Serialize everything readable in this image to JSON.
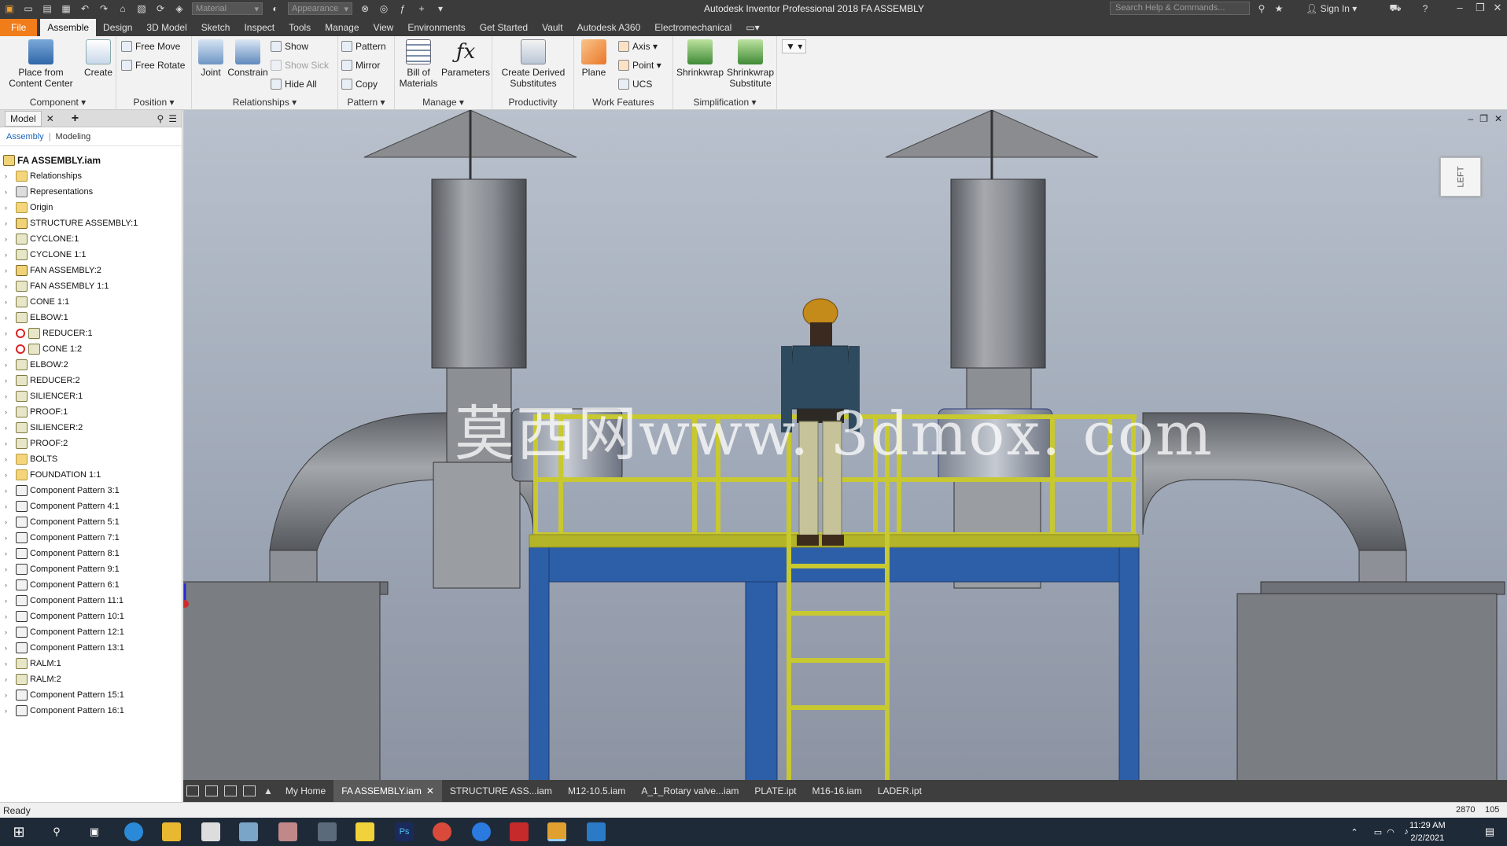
{
  "titlebar": {
    "title": "Autodesk Inventor Professional 2018   FA ASSEMBLY",
    "material_combo": "Material",
    "appearance_combo": "Appearance",
    "search_placeholder": "Search Help & Commands...",
    "sign_in": "Sign In"
  },
  "ribbon_tabs": [
    "File",
    "Assemble",
    "Design",
    "3D Model",
    "Sketch",
    "Inspect",
    "Tools",
    "Manage",
    "View",
    "Environments",
    "Get Started",
    "Vault",
    "Autodesk A360",
    "Electromechanical"
  ],
  "active_tab": "Assemble",
  "ribbon": {
    "component": {
      "title": "Component ▾",
      "place": "Place from\nContent Center",
      "create": "Create"
    },
    "position": {
      "title": "Position ▾",
      "free_move": "Free Move",
      "free_rotate": "Free Rotate"
    },
    "relationships": {
      "title": "Relationships ▾",
      "joint": "Joint",
      "constrain": "Constrain",
      "show": "Show",
      "show_sick": "Show Sick",
      "hide_all": "Hide All"
    },
    "pattern": {
      "title": "Pattern ▾",
      "pattern": "Pattern",
      "mirror": "Mirror",
      "copy": "Copy"
    },
    "manage": {
      "title": "Manage ▾",
      "bom": "Bill of\nMaterials",
      "parameters": "Parameters"
    },
    "productivity": {
      "title": "Productivity",
      "derived": "Create Derived\nSubstitutes"
    },
    "work_features": {
      "title": "Work Features",
      "plane": "Plane",
      "axis": "Axis",
      "point": "Point",
      "ucs": "UCS"
    },
    "simplification": {
      "title": "Simplification ▾",
      "shrinkwrap": "Shrinkwrap",
      "shrinkwrap_sub": "Shrinkwrap\nSubstitute"
    }
  },
  "browser": {
    "tab": "Model",
    "subtab_assembly": "Assembly",
    "subtab_modeling": "Modeling",
    "root": "FA ASSEMBLY.iam",
    "items": [
      {
        "label": "Relationships",
        "icon": "folder"
      },
      {
        "label": "Representations",
        "icon": "rep"
      },
      {
        "label": "Origin",
        "icon": "folder"
      },
      {
        "label": "STRUCTURE ASSEMBLY:1",
        "icon": "asm"
      },
      {
        "label": "CYCLONE:1",
        "icon": "part"
      },
      {
        "label": "CYCLONE 1:1",
        "icon": "part"
      },
      {
        "label": "FAN ASSEMBLY:2",
        "icon": "asm"
      },
      {
        "label": "FAN ASSEMBLY 1:1",
        "icon": "part"
      },
      {
        "label": "CONE 1:1",
        "icon": "part"
      },
      {
        "label": "ELBOW:1",
        "icon": "part"
      },
      {
        "label": "REDUCER:1",
        "icon": "part",
        "error": true
      },
      {
        "label": "CONE 1:2",
        "icon": "part",
        "error": true
      },
      {
        "label": "ELBOW:2",
        "icon": "part"
      },
      {
        "label": "REDUCER:2",
        "icon": "part"
      },
      {
        "label": "SILIENCER:1",
        "icon": "part"
      },
      {
        "label": "PROOF:1",
        "icon": "part"
      },
      {
        "label": "SILIENCER:2",
        "icon": "part"
      },
      {
        "label": "PROOF:2",
        "icon": "part"
      },
      {
        "label": "BOLTS",
        "icon": "folder"
      },
      {
        "label": "FOUNDATION 1:1",
        "icon": "folder"
      },
      {
        "label": "Component Pattern 3:1",
        "icon": "pattern"
      },
      {
        "label": "Component Pattern 4:1",
        "icon": "pattern"
      },
      {
        "label": "Component Pattern 5:1",
        "icon": "pattern"
      },
      {
        "label": "Component Pattern 7:1",
        "icon": "pattern"
      },
      {
        "label": "Component Pattern 8:1",
        "icon": "pattern"
      },
      {
        "label": "Component Pattern 9:1",
        "icon": "pattern"
      },
      {
        "label": "Component Pattern 6:1",
        "icon": "pattern"
      },
      {
        "label": "Component Pattern 11:1",
        "icon": "pattern"
      },
      {
        "label": "Component Pattern 10:1",
        "icon": "pattern"
      },
      {
        "label": "Component Pattern 12:1",
        "icon": "pattern"
      },
      {
        "label": "Component Pattern 13:1",
        "icon": "pattern"
      },
      {
        "label": "RALM:1",
        "icon": "part"
      },
      {
        "label": "RALM:2",
        "icon": "part"
      },
      {
        "label": "Component Pattern 15:1",
        "icon": "pattern"
      },
      {
        "label": "Component Pattern 16:1",
        "icon": "pattern"
      }
    ]
  },
  "viewport": {
    "viewcube_label": "LEFT",
    "watermark": "莫西网www. 3dmox. com"
  },
  "document_tabs": [
    "My Home",
    "FA ASSEMBLY.iam",
    "STRUCTURE ASS...iam",
    "M12-10.5.iam",
    "A_1_Rotary valve...iam",
    "PLATE.ipt",
    "M16-16.iam",
    "LADER.ipt"
  ],
  "active_document": "FA ASSEMBLY.iam",
  "status": {
    "text": "Ready",
    "count1": "2870",
    "count2": "105"
  },
  "taskbar": {
    "time": "11:29 AM",
    "date": "2/2/2021"
  },
  "colors": {
    "file_tab": "#f07d1a",
    "rail_yellow": "#c8c830",
    "frame_blue": "#2d5fa8"
  }
}
